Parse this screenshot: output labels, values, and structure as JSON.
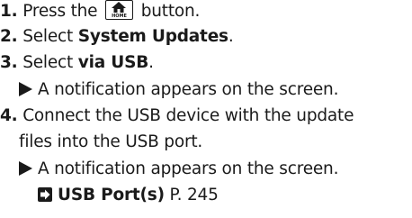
{
  "steps": [
    {
      "number": "1.",
      "text_before": "Press the",
      "button_label": "HOME",
      "button_icon": "home-icon",
      "text_after": "button."
    },
    {
      "number": "2.",
      "text_before": "Select ",
      "bold_text": "System Updates",
      "text_after": "."
    },
    {
      "number": "3.",
      "text_before": "Select ",
      "bold_text": "via USB",
      "text_after": ".",
      "result": "A notification appears on the screen."
    },
    {
      "number": "4.",
      "text_line1": "Connect the USB device with the update",
      "text_line2": "files into the USB port.",
      "result": "A notification appears on the screen.",
      "reference": {
        "icon": "reference-arrow-icon",
        "title": "USB Port(s)",
        "page": "P. 245"
      }
    }
  ]
}
